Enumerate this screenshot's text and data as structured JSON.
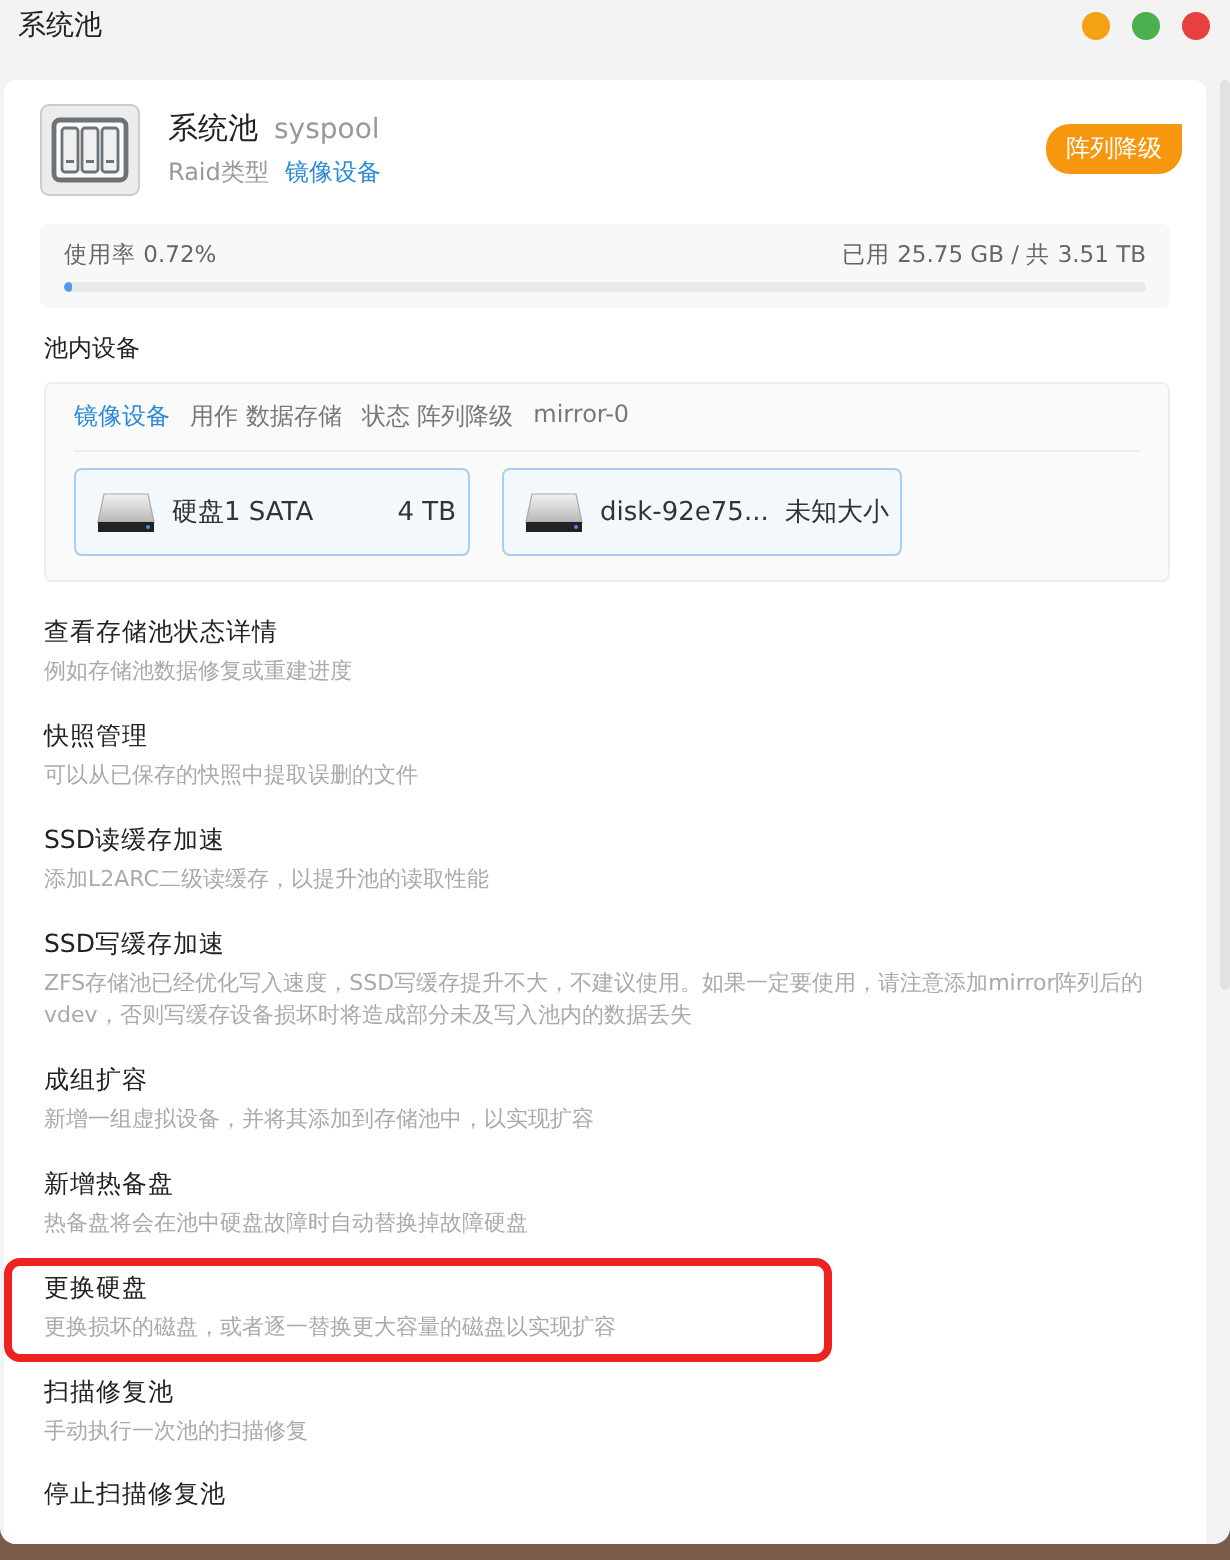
{
  "window": {
    "title": "系统池"
  },
  "pool": {
    "name": "系统池",
    "id": "syspool",
    "raid_label": "Raid类型",
    "raid_type": "镜像设备",
    "status_badge": "阵列降级",
    "usage_label": "使用率 0.72%",
    "usage_text": "已用 25.75 GB / 共 3.51 TB",
    "level": 0.0072
  },
  "devices": {
    "title": "池内设备",
    "group": {
      "type": "镜像设备",
      "usage": "用作 数据存储",
      "status": "状态 阵列降级",
      "name": "mirror-0"
    },
    "disks": [
      {
        "name": "硬盘1 SATA",
        "size": "4 TB"
      },
      {
        "name": "disk-92e75...",
        "size": "未知大小"
      }
    ]
  },
  "actions": [
    {
      "title": "查看存储池状态详情",
      "description": "例如存储池数据修复或重建进度",
      "highlighted": false
    },
    {
      "title": "快照管理",
      "description": "可以从已保存的快照中提取误删的文件",
      "highlighted": false
    },
    {
      "title": "SSD读缓存加速",
      "description": "添加L2ARC二级读缓存，以提升池的读取性能",
      "highlighted": false
    },
    {
      "title": "SSD写缓存加速",
      "description": "ZFS存储池已经优化写入速度，SSD写缓存提升不大，不建议使用。如果一定要使用，请注意添加mirror阵列后的vdev，否则写缓存设备损坏时将造成部分未及写入池内的数据丢失",
      "highlighted": false
    },
    {
      "title": "成组扩容",
      "description": "新增一组虚拟设备，并将其添加到存储池中，以实现扩容",
      "highlighted": false
    },
    {
      "title": "新增热备盘",
      "description": "热备盘将会在池中硬盘故障时自动替换掉故障硬盘",
      "highlighted": false
    },
    {
      "title": "更换硬盘",
      "description": "更换损坏的磁盘，或者逐一替换更大容量的磁盘以实现扩容",
      "highlighted": true
    },
    {
      "title": "扫描修复池",
      "description": "手动执行一次池的扫描修复",
      "highlighted": false
    },
    {
      "title": "停止扫描修复池",
      "highlighted": false
    }
  ]
}
